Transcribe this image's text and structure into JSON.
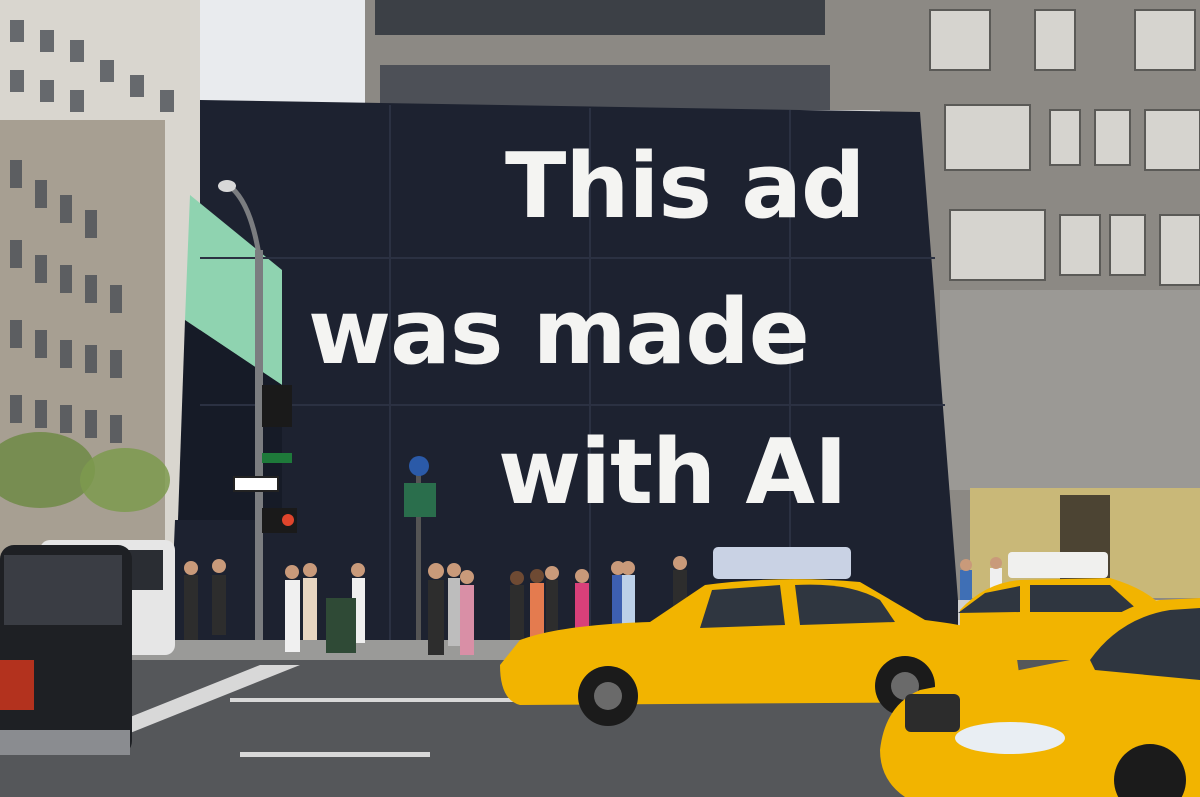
{
  "billboard": {
    "lines": [
      "This ad",
      "was made",
      "with AI"
    ]
  },
  "colors": {
    "sky": "#e9ebee",
    "billboard": "#1d2230",
    "billboard_text": "#f4f4f2",
    "taxi_yellow": "#f2b400",
    "building_stone": "#8c8984",
    "asphalt": "#55575a",
    "mint_panel": "#8fd3b0"
  }
}
